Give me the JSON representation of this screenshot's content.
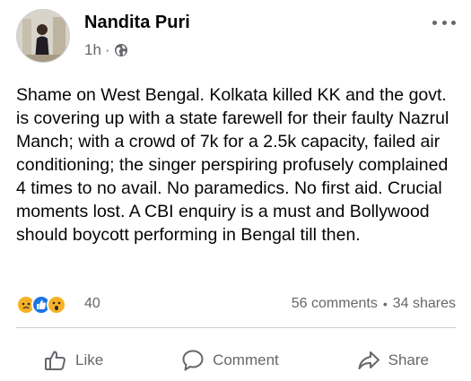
{
  "post": {
    "author": "Nandita Puri",
    "time": "1h",
    "time_separator": "·",
    "privacy_icon": "globe-icon",
    "text": "Shame on West Bengal. Kolkata killed KK  and the govt. is covering up with a state farewell for their faulty Nazrul Manch; with a crowd of 7k for a 2.5k capacity, failed air conditioning; the singer perspiring profusely complained 4 times to no avail. No paramedics. No first aid. Crucial moments lost.  A CBI enquiry is a must and Bollywood should boycott performing in Bengal till then."
  },
  "reactions": {
    "icons": [
      "sad-reaction-icon",
      "like-reaction-icon",
      "wow-reaction-icon"
    ],
    "count": "40",
    "comments": "56 comments",
    "separator": "•",
    "shares": "34 shares"
  },
  "actions": {
    "like_label": "Like",
    "comment_label": "Comment",
    "share_label": "Share"
  },
  "colors": {
    "text": "#050505",
    "secondary": "#65676b",
    "like_blue": "#1b74e4",
    "emoji_yellow": "#f7b125",
    "divider": "#ced0d4"
  }
}
